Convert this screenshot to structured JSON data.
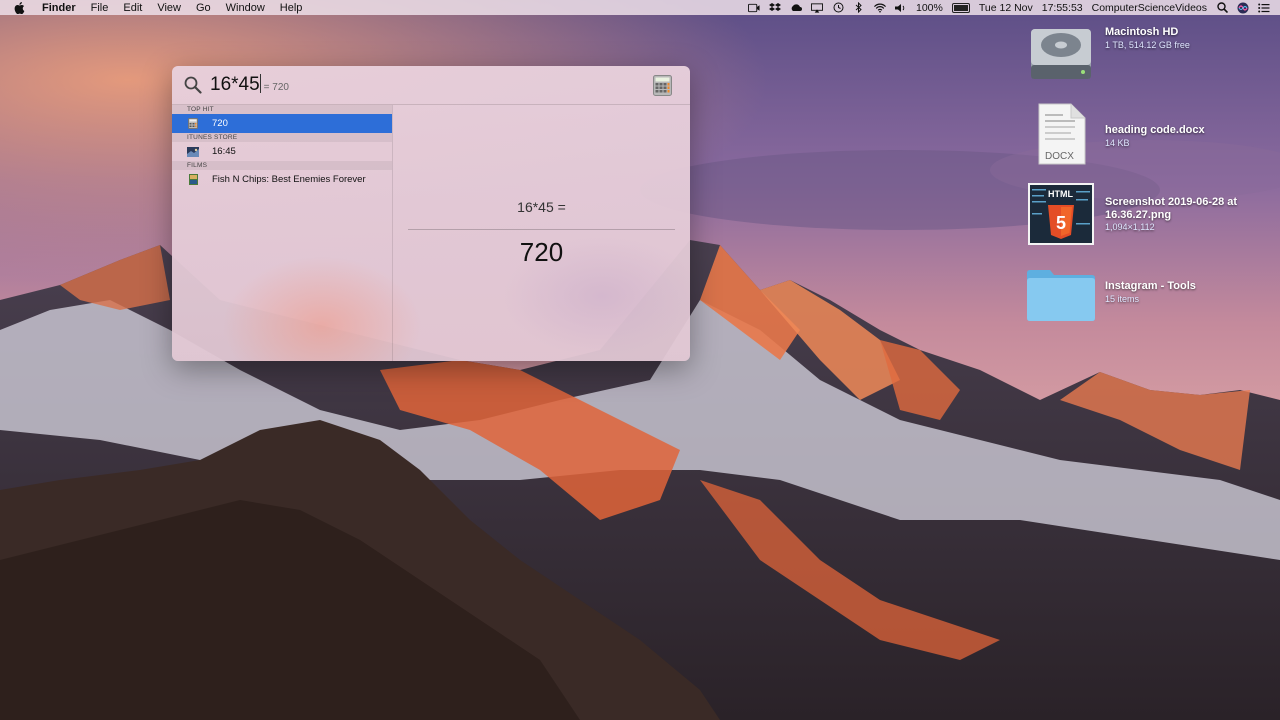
{
  "menubar": {
    "app_name": "Finder",
    "menus": [
      "File",
      "Edit",
      "View",
      "Go",
      "Window",
      "Help"
    ],
    "battery_text": "100%",
    "date": "Tue 12 Nov",
    "time": "17:55:53",
    "user": "ComputerScienceVideos"
  },
  "spotlight": {
    "query": "16*45",
    "query_hint": "= 720",
    "sections": [
      {
        "header": "TOP HIT",
        "items": [
          {
            "label": "720",
            "icon": "calculator-icon",
            "selected": true
          }
        ]
      },
      {
        "header": "ITUNES STORE",
        "items": [
          {
            "label": "16:45",
            "icon": "itunes-store-icon",
            "selected": false
          }
        ]
      },
      {
        "header": "FILMS",
        "items": [
          {
            "label": "Fish N Chips: Best Enemies Forever",
            "icon": "film-icon",
            "selected": false
          }
        ]
      }
    ],
    "preview": {
      "expression": "16*45 =",
      "result": "720"
    }
  },
  "desktop": {
    "items": [
      {
        "name": "Macintosh HD",
        "info": "1 TB, 514.12 GB free",
        "icon": "hard-drive-icon"
      },
      {
        "name": "heading code.docx",
        "info": "14 KB",
        "icon": "docx-file-icon",
        "badge": "DOCX"
      },
      {
        "name": "Screenshot 2019-06-28 at 16.36.27.png",
        "info": "1,094×1,112",
        "icon": "image-thumbnail-icon",
        "thumb_text": "HTML"
      },
      {
        "name": "Instagram - Tools",
        "info": "15 items",
        "icon": "folder-icon"
      }
    ]
  },
  "colors": {
    "selection": "#2d6ed8",
    "menubar_bg": "#ecdee8",
    "folder": "#7fc3ec"
  }
}
